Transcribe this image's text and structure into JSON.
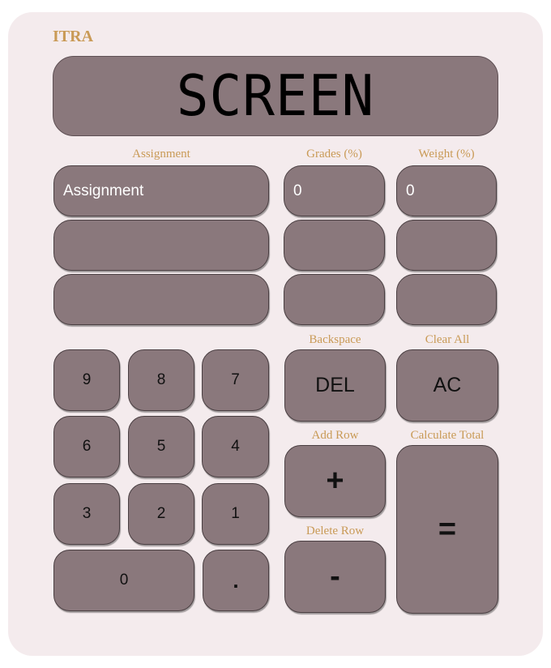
{
  "brand": "ITRA",
  "screen": "SCREEN",
  "labels": {
    "assignment": "Assignment",
    "grades": "Grades (%)",
    "weight": "Weight (%)",
    "backspace": "Backspace",
    "clear_all": "Clear All",
    "add_row": "Add Row",
    "calculate_total": "Calculate Total",
    "delete_row": "Delete Row"
  },
  "rows": [
    {
      "assignment": "Assignment",
      "grade": "0",
      "weight": "0"
    },
    {
      "assignment": "",
      "grade": "",
      "weight": ""
    },
    {
      "assignment": "",
      "grade": "",
      "weight": ""
    }
  ],
  "keys": {
    "k9": "9",
    "k8": "8",
    "k7": "7",
    "k6": "6",
    "k5": "5",
    "k4": "4",
    "k3": "3",
    "k2": "2",
    "k1": "1",
    "k0": "0",
    "dot": "."
  },
  "ops": {
    "del": "DEL",
    "ac": "AC",
    "plus": "+",
    "equals": "=",
    "minus": "-"
  }
}
